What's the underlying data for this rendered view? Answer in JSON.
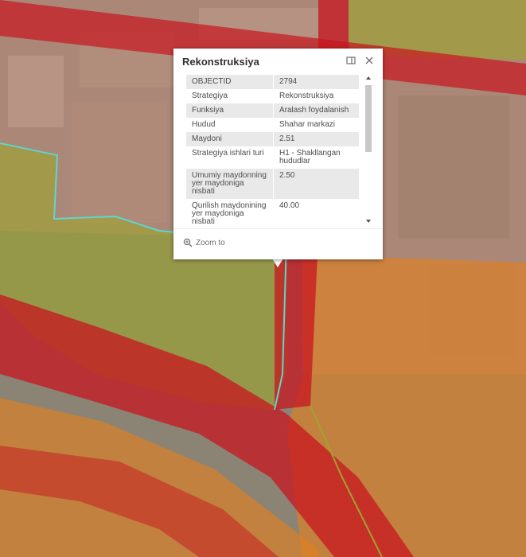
{
  "map": {
    "colors": {
      "imagery_base": "#8b8474",
      "red_zone": "#c7161f",
      "green_zone": "#9ea52d",
      "orange_zone": "#e07f22",
      "pink_overlay": "#c58a7a",
      "cyan_outline": "#5fd5cf"
    }
  },
  "popup": {
    "title": "Rekonstruksiya",
    "attributes": [
      {
        "key": "OBJECTID",
        "value": "2794"
      },
      {
        "key": "Strategiya",
        "value": "Rekonstruksiya"
      },
      {
        "key": "Funksiya",
        "value": "Aralash foydalanish"
      },
      {
        "key": "Hudud",
        "value": "Shahar markazi"
      },
      {
        "key": "Maydoni",
        "value": "2.51"
      },
      {
        "key": "Strategiya ishlari turi",
        "value": "H1 - Shakllangan hududlar"
      },
      {
        "key": "Umumiy maydonning yer maydoniga nisbati",
        "value": "2.50"
      },
      {
        "key": "Qurilish maydonining yer maydoniga nisbati",
        "value": "40.00"
      }
    ],
    "zoom_label": "Zoom to",
    "icons": {
      "dock": "dock-icon",
      "close": "close-icon",
      "zoom": "zoom-to-icon"
    }
  }
}
